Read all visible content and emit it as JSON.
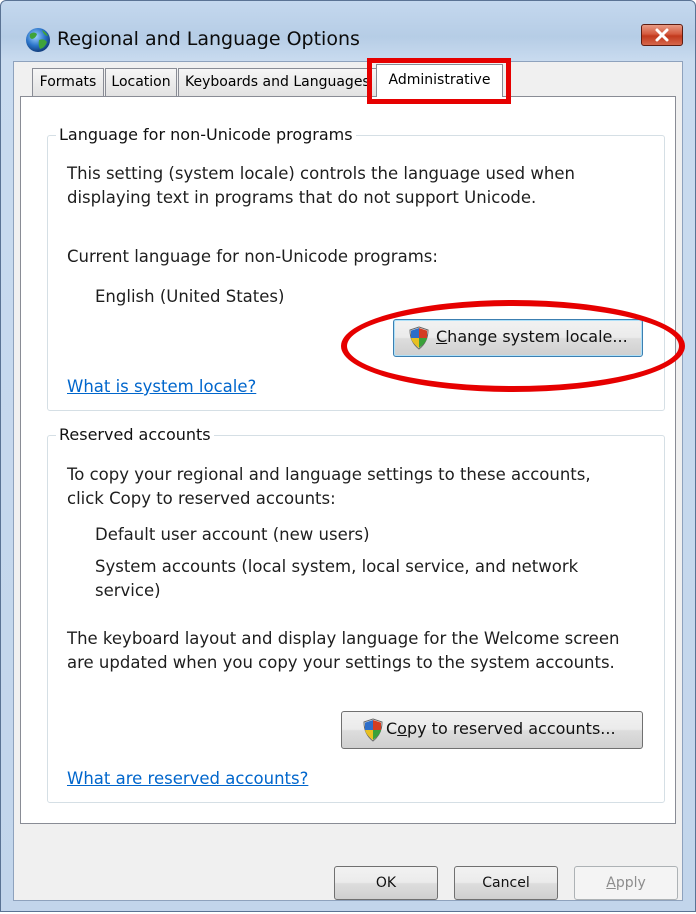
{
  "window": {
    "title": "Regional and Language Options"
  },
  "tabs": [
    {
      "label": "Formats",
      "active": false
    },
    {
      "label": "Location",
      "active": false
    },
    {
      "label": "Keyboards and Languages",
      "active": false
    },
    {
      "label": "Administrative",
      "active": true
    }
  ],
  "non_unicode": {
    "legend": "Language for non-Unicode programs",
    "description_line1": "This setting (system locale) controls the language used when",
    "description_line2": "displaying text in programs that do not support Unicode.",
    "current_label": "Current language for non-Unicode programs:",
    "current_value": "English (United States)",
    "change_button_accel": "C",
    "change_button_rest": "hange system locale...",
    "help_link": "What is system locale?"
  },
  "reserved": {
    "legend": "Reserved accounts",
    "intro_line1": "To copy your regional and language settings to these accounts,",
    "intro_line2": "click Copy to reserved accounts:",
    "item1": "Default user account (new users)",
    "item2_line1": "System accounts (local system, local service, and network",
    "item2_line2": "service)",
    "note_line1": "The keyboard layout and display language for the Welcome screen",
    "note_line2": "are updated when you copy your settings to the system accounts.",
    "copy_button_pre": "C",
    "copy_button_accel": "o",
    "copy_button_rest": "py to reserved accounts...",
    "help_link": "What are reserved accounts?"
  },
  "footer": {
    "ok": "OK",
    "cancel": "Cancel",
    "apply_accel": "A",
    "apply_rest": "pply"
  },
  "colors": {
    "annotation": "#e60000",
    "link": "#0066cc",
    "close_button": "#c2391d"
  },
  "icons": [
    "globe-icon",
    "close-icon",
    "uac-shield-icon"
  ]
}
